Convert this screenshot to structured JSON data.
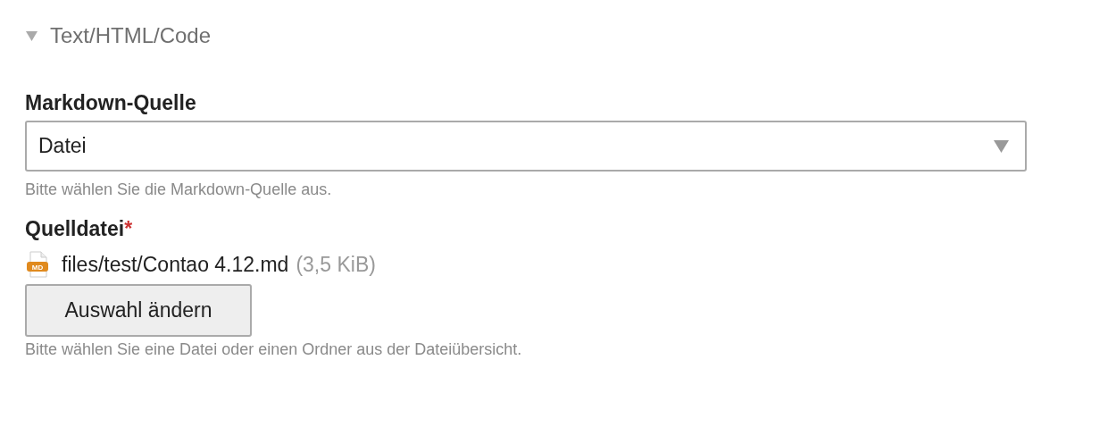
{
  "section": {
    "title": "Text/HTML/Code",
    "expanded": true
  },
  "fields": [
    {
      "kind": "select",
      "label": "Markdown-Quelle",
      "value": "Datei",
      "hint": "Bitte wählen Sie die Markdown-Quelle aus."
    },
    {
      "kind": "file",
      "label": "Quelldatei",
      "required_mark": "*",
      "file": {
        "badge": "MD",
        "path": "files/test/Contao 4.12.md",
        "size": "(3,5 KiB)"
      },
      "button": "Auswahl ändern",
      "hint": "Bitte wählen Sie eine Datei oder einen Ordner aus der Dateiübersicht."
    }
  ]
}
